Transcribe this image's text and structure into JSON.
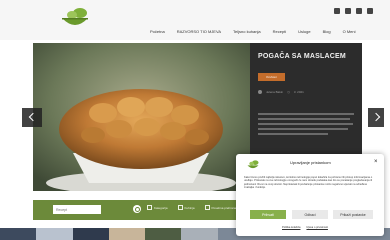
{
  "header": {
    "nav": [
      "Početna",
      "RAZVORSO TIO MJEVA",
      "Teljsno kuhanja",
      "Recepti",
      "Usluge",
      "Blog",
      "O Meni"
    ],
    "social_icons": [
      "facebook-icon",
      "instagram-icon",
      "pinterest-icon",
      "youtube-icon"
    ],
    "logo_icon": "leaf-bowl-logo-icon"
  },
  "hero": {
    "title": "POGAČA SA MASLACEM",
    "category_button": "Kruhovi",
    "meta_author": "Jelena Bakin",
    "meta_date": "3. 2021"
  },
  "search": {
    "placeholder": "Recept",
    "filters": [
      "Kategorija",
      "Kuhinja",
      "Posebna prehrana"
    ]
  },
  "cookie_dialog": {
    "title": "Upravljanje pristankom",
    "close": "×",
    "text": "Kako bismo pružili najbolje iskustvo, koristimo tehnologije poput kolačića za pohranu i/ili pristup informacijama o uređaju. Pristanak na ove tehnologije omogućit će nam obradu podataka kao što su ponašanje pregledavanja ili jedinstveni ID-ovi na ovoj stranici. Nepristanak ili povlačenje pristanka može negativno utjecati na određene značajke i funkcije.",
    "accept": "Prihvati",
    "reject": "Odbaci",
    "settings": "Prikaži postavke",
    "links": [
      "Politika kolačića",
      "Izjava o privatnosti"
    ]
  },
  "colors": {
    "accent_green": "#88b04b",
    "bar_green": "#6c8a3a",
    "category_orange": "#c46d2b",
    "panel_dark": "#2c2c2c"
  }
}
